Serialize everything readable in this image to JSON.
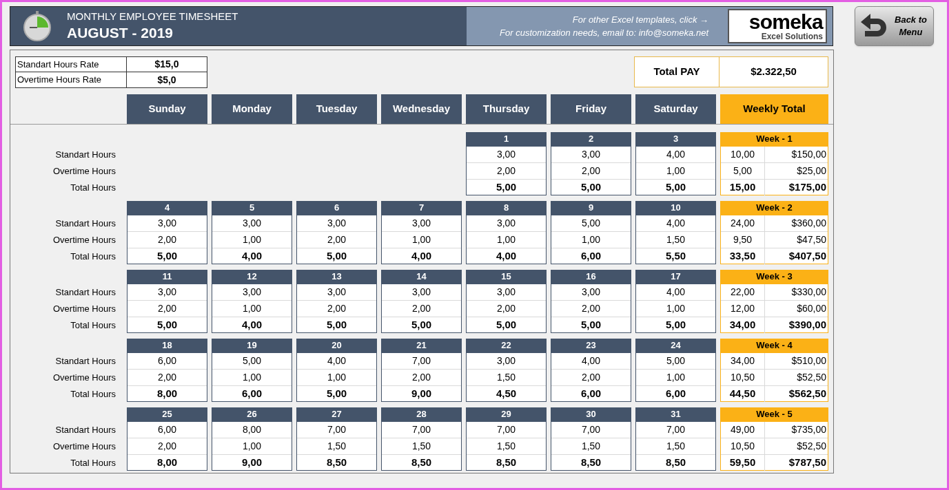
{
  "header": {
    "title": "MONTHLY EMPLOYEE TIMESHEET",
    "period": "AUGUST - 2019",
    "promo_lines": [
      "For other Excel templates, click →",
      "For customization needs, email to: info@someka.net"
    ],
    "logo": {
      "name": "someka",
      "tagline": "Excel Solutions"
    }
  },
  "back_button": {
    "label_lines": [
      "Back to",
      "Menu"
    ]
  },
  "rates": [
    {
      "label": "Standart Hours Rate",
      "value": "$15,0"
    },
    {
      "label": "Overtime Hours Rate",
      "value": "$5,0"
    }
  ],
  "total_pay": {
    "label": "Total PAY",
    "value": "$2.322,50"
  },
  "columns": [
    "Sunday",
    "Monday",
    "Tuesday",
    "Wednesday",
    "Thursday",
    "Friday",
    "Saturday"
  ],
  "weekly_total_column": "Weekly Total",
  "weeks": [
    {
      "row_labels": [
        "Standart Hours",
        "Overtime Hours",
        "Total Hours"
      ],
      "days": [
        {
          "date": "1",
          "standard": "3,00",
          "overtime": "2,00",
          "total": "5,00"
        },
        {
          "date": "2",
          "standard": "3,00",
          "overtime": "2,00",
          "total": "5,00"
        },
        {
          "date": "3",
          "standard": "4,00",
          "overtime": "1,00",
          "total": "5,00"
        }
      ],
      "summary": {
        "label": "Week - 1",
        "standard_hours": "10,00",
        "standard_pay": "$150,00",
        "overtime_hours": "5,00",
        "overtime_pay": "$25,00",
        "total_hours": "15,00",
        "total_pay": "$175,00"
      }
    },
    {
      "row_labels": [
        "Standart Hours",
        "Overtime Hours",
        "Total Hours"
      ],
      "days": [
        {
          "date": "4",
          "standard": "3,00",
          "overtime": "2,00",
          "total": "5,00"
        },
        {
          "date": "5",
          "standard": "3,00",
          "overtime": "1,00",
          "total": "4,00"
        },
        {
          "date": "6",
          "standard": "3,00",
          "overtime": "2,00",
          "total": "5,00"
        },
        {
          "date": "7",
          "standard": "3,00",
          "overtime": "1,00",
          "total": "4,00"
        },
        {
          "date": "8",
          "standard": "3,00",
          "overtime": "1,00",
          "total": "4,00"
        },
        {
          "date": "9",
          "standard": "5,00",
          "overtime": "1,00",
          "total": "6,00"
        },
        {
          "date": "10",
          "standard": "4,00",
          "overtime": "1,50",
          "total": "5,50"
        }
      ],
      "summary": {
        "label": "Week - 2",
        "standard_hours": "24,00",
        "standard_pay": "$360,00",
        "overtime_hours": "9,50",
        "overtime_pay": "$47,50",
        "total_hours": "33,50",
        "total_pay": "$407,50"
      }
    },
    {
      "row_labels": [
        "Standart Hours",
        "Overtime Hours",
        "Total Hours"
      ],
      "days": [
        {
          "date": "11",
          "standard": "3,00",
          "overtime": "2,00",
          "total": "5,00"
        },
        {
          "date": "12",
          "standard": "3,00",
          "overtime": "1,00",
          "total": "4,00"
        },
        {
          "date": "13",
          "standard": "3,00",
          "overtime": "2,00",
          "total": "5,00"
        },
        {
          "date": "14",
          "standard": "3,00",
          "overtime": "2,00",
          "total": "5,00"
        },
        {
          "date": "15",
          "standard": "3,00",
          "overtime": "2,00",
          "total": "5,00"
        },
        {
          "date": "16",
          "standard": "3,00",
          "overtime": "2,00",
          "total": "5,00"
        },
        {
          "date": "17",
          "standard": "4,00",
          "overtime": "1,00",
          "total": "5,00"
        }
      ],
      "summary": {
        "label": "Week - 3",
        "standard_hours": "22,00",
        "standard_pay": "$330,00",
        "overtime_hours": "12,00",
        "overtime_pay": "$60,00",
        "total_hours": "34,00",
        "total_pay": "$390,00"
      }
    },
    {
      "row_labels": [
        "Standart Hours",
        "Overtime Hours",
        "Total Hours"
      ],
      "days": [
        {
          "date": "18",
          "standard": "6,00",
          "overtime": "2,00",
          "total": "8,00"
        },
        {
          "date": "19",
          "standard": "5,00",
          "overtime": "1,00",
          "total": "6,00"
        },
        {
          "date": "20",
          "standard": "4,00",
          "overtime": "1,00",
          "total": "5,00"
        },
        {
          "date": "21",
          "standard": "7,00",
          "overtime": "2,00",
          "total": "9,00"
        },
        {
          "date": "22",
          "standard": "3,00",
          "overtime": "1,50",
          "total": "4,50"
        },
        {
          "date": "23",
          "standard": "4,00",
          "overtime": "2,00",
          "total": "6,00"
        },
        {
          "date": "24",
          "standard": "5,00",
          "overtime": "1,00",
          "total": "6,00"
        }
      ],
      "summary": {
        "label": "Week - 4",
        "standard_hours": "34,00",
        "standard_pay": "$510,00",
        "overtime_hours": "10,50",
        "overtime_pay": "$52,50",
        "total_hours": "44,50",
        "total_pay": "$562,50"
      }
    },
    {
      "row_labels": [
        "Standart Hours",
        "Overtime Hours",
        "Total Hours"
      ],
      "days": [
        {
          "date": "25",
          "standard": "6,00",
          "overtime": "2,00",
          "total": "8,00"
        },
        {
          "date": "26",
          "standard": "8,00",
          "overtime": "1,00",
          "total": "9,00"
        },
        {
          "date": "27",
          "standard": "7,00",
          "overtime": "1,50",
          "total": "8,50"
        },
        {
          "date": "28",
          "standard": "7,00",
          "overtime": "1,50",
          "total": "8,50"
        },
        {
          "date": "29",
          "standard": "7,00",
          "overtime": "1,50",
          "total": "8,50"
        },
        {
          "date": "30",
          "standard": "7,00",
          "overtime": "1,50",
          "total": "8,50"
        },
        {
          "date": "31",
          "standard": "7,00",
          "overtime": "1,50",
          "total": "8,50"
        }
      ],
      "summary": {
        "label": "Week - 5",
        "standard_hours": "49,00",
        "standard_pay": "$735,00",
        "overtime_hours": "10,50",
        "overtime_pay": "$52,50",
        "total_hours": "59,50",
        "total_pay": "$787,50"
      }
    }
  ]
}
